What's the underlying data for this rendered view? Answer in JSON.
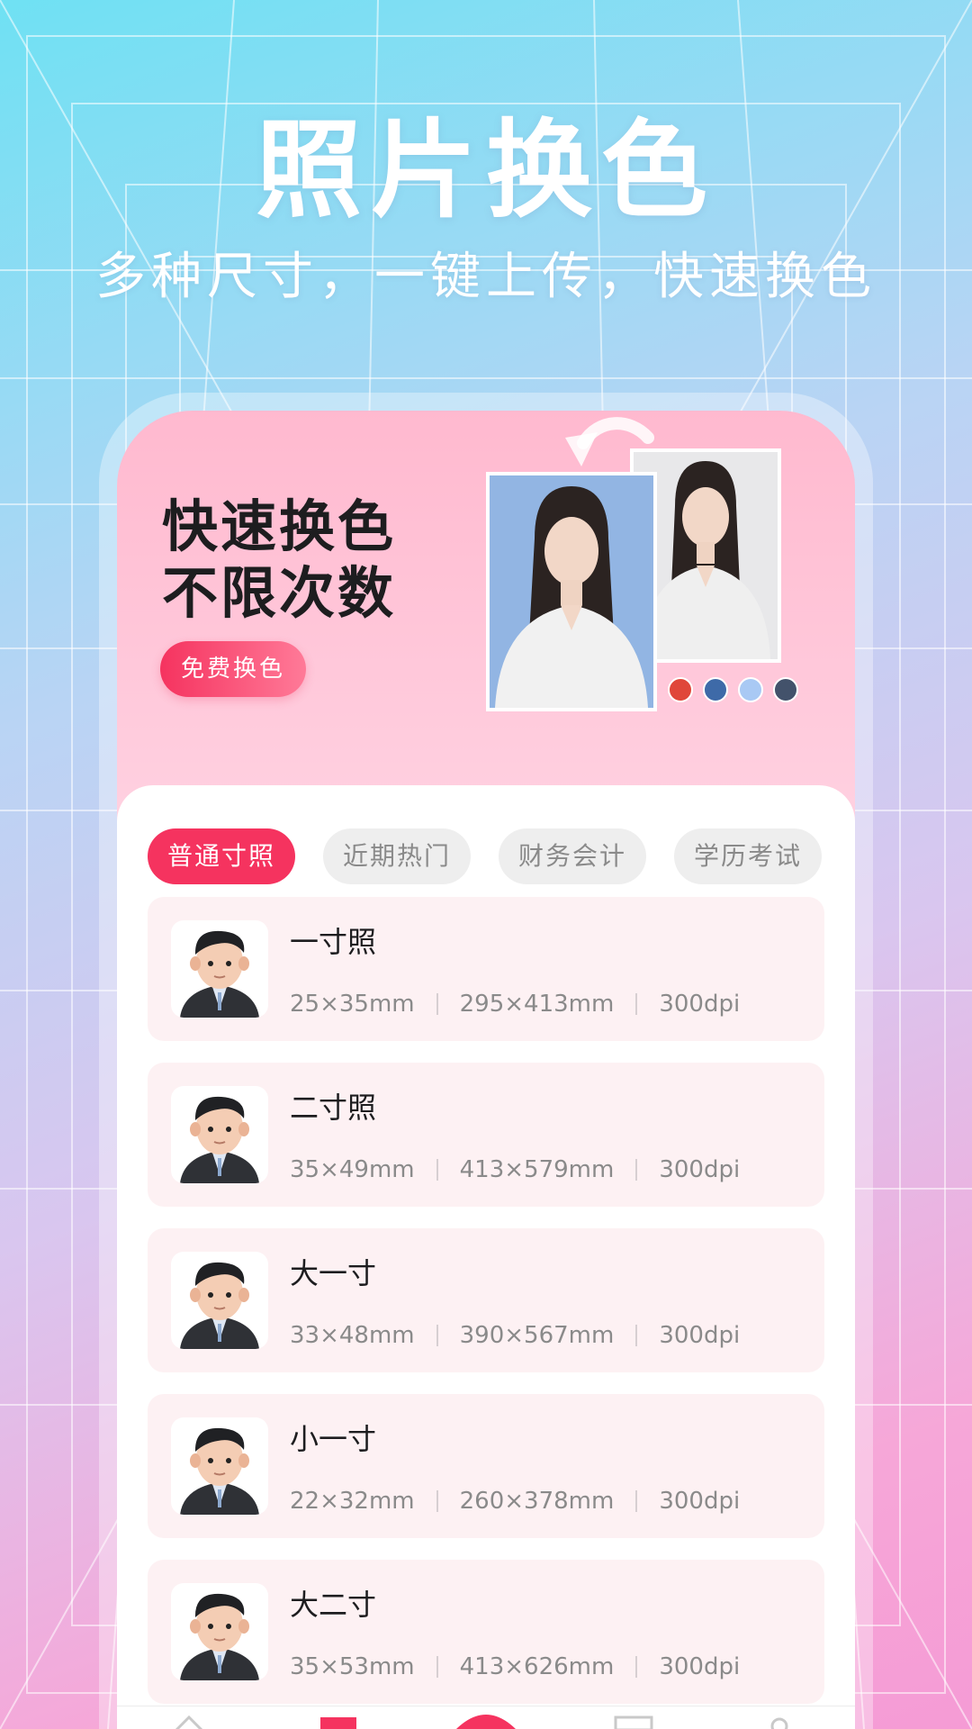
{
  "hero": {
    "title": "照片换色",
    "subtitle": "多种尺寸，一键上传，快速换色"
  },
  "promo": {
    "line1": "快速换色",
    "line2": "不限次数",
    "button_label": "免费换色",
    "swatches": [
      "#e0473a",
      "#3e6aa8",
      "#a9c9f4",
      "#43526b"
    ]
  },
  "tabs": [
    {
      "label": "普通寸照",
      "active": true
    },
    {
      "label": "近期热门",
      "active": false
    },
    {
      "label": "财务会计",
      "active": false
    },
    {
      "label": "学历考试",
      "active": false
    }
  ],
  "items": [
    {
      "title": "一寸照",
      "size_mm": "25×35mm",
      "size_px": "295×413mm",
      "dpi": "300dpi"
    },
    {
      "title": "二寸照",
      "size_mm": "35×49mm",
      "size_px": "413×579mm",
      "dpi": "300dpi"
    },
    {
      "title": "大一寸",
      "size_mm": "33×48mm",
      "size_px": "390×567mm",
      "dpi": "300dpi"
    },
    {
      "title": "小一寸",
      "size_mm": "22×32mm",
      "size_px": "260×378mm",
      "dpi": "300dpi"
    },
    {
      "title": "大二寸",
      "size_mm": "35×53mm",
      "size_px": "413×626mm",
      "dpi": "300dpi"
    }
  ],
  "colors": {
    "accent": "#f5335f",
    "item_bg": "#fdf1f3"
  }
}
